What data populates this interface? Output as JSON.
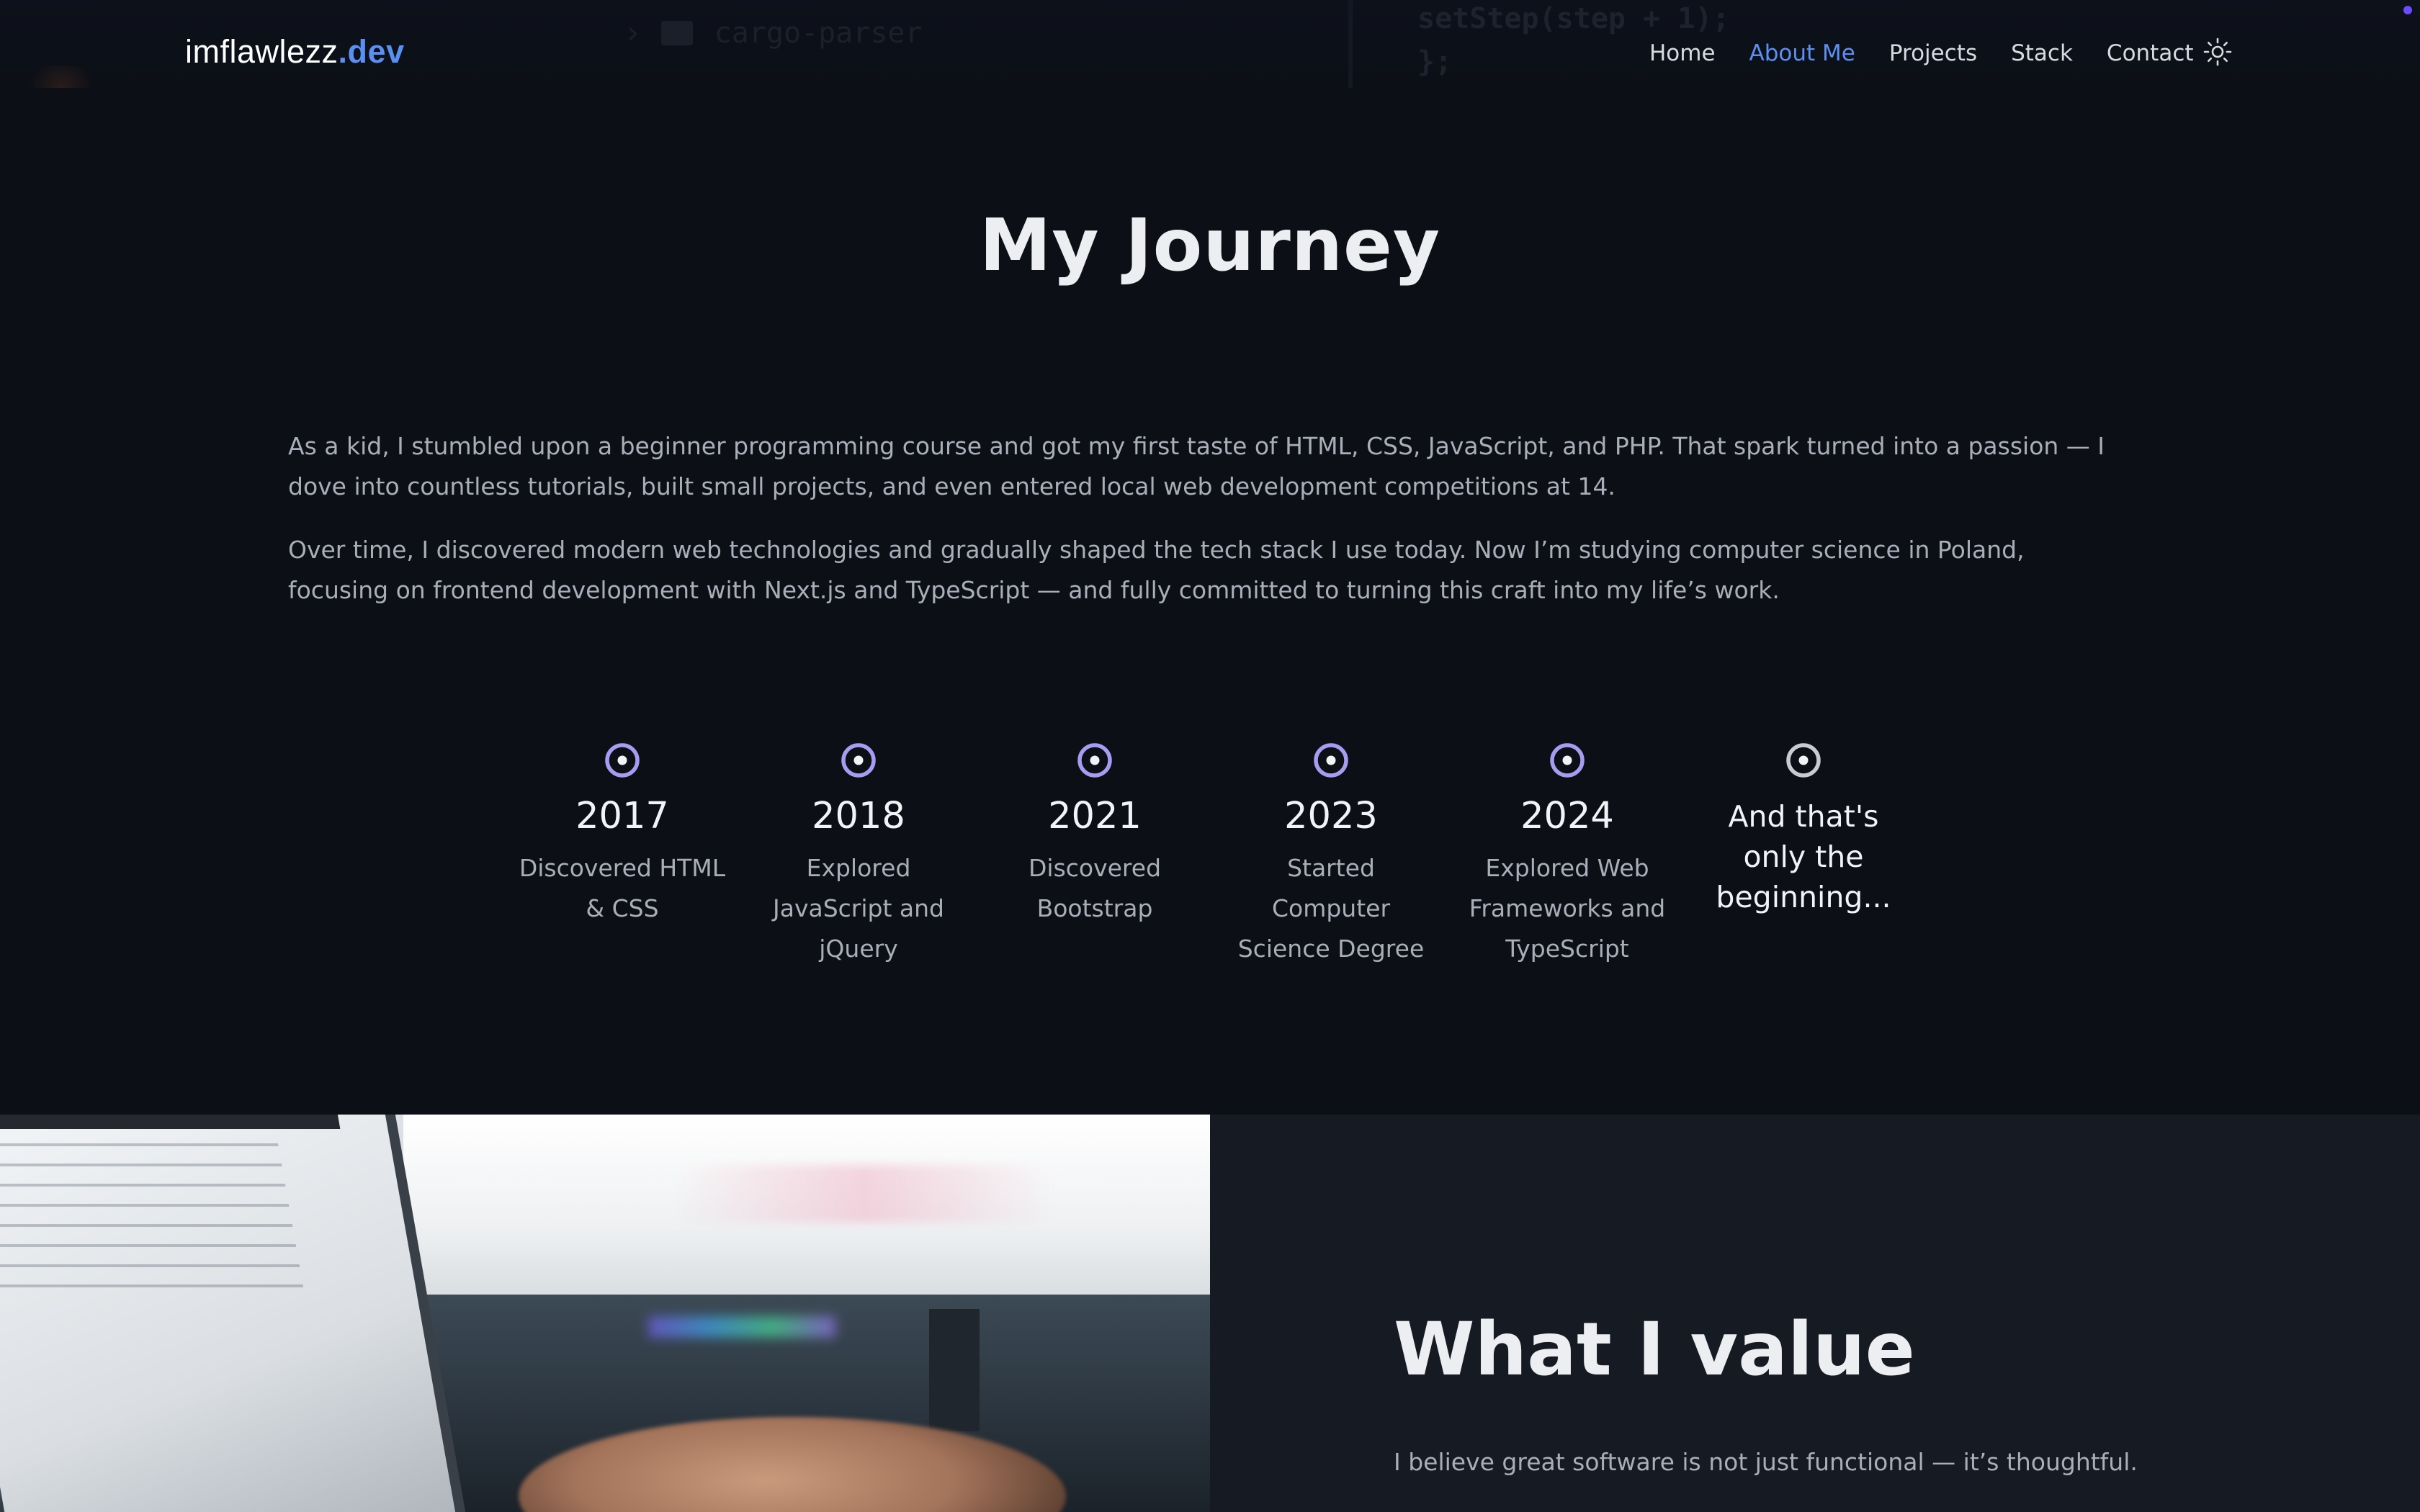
{
  "nav": {
    "logo_main": "imflawlezz",
    "logo_accent": ".dev",
    "links": [
      {
        "label": "Home",
        "active": false
      },
      {
        "label": "About Me",
        "active": true
      },
      {
        "label": "Projects",
        "active": false
      },
      {
        "label": "Stack",
        "active": false
      },
      {
        "label": "Contact",
        "active": false
      }
    ],
    "theme_icon": "sun-icon",
    "background_code_line1": "setStep(step + 1);",
    "background_code_line2": "};",
    "background_folder": "cargo-parser"
  },
  "journey": {
    "title": "My Journey",
    "paragraphs": [
      "As a kid, I stumbled upon a beginner programming course and got my first taste of HTML, CSS, JavaScript, and PHP. That spark turned into a passion — I dove into countless tutorials, built small projects, and even entered local web development competitions at 14.",
      "Over time, I discovered modern web technologies and gradually shaped the tech stack I use today. Now I’m studying computer science in Poland, focusing on frontend development with Next.js and TypeScript — and fully committed to turning this craft into my life’s work."
    ],
    "timeline": [
      {
        "year": "2017",
        "desc": "Discovered HTML & CSS"
      },
      {
        "year": "2018",
        "desc": "Explored JavaScript and jQuery"
      },
      {
        "year": "2021",
        "desc": "Discovered Bootstrap"
      },
      {
        "year": "2023",
        "desc": "Started Computer Science Degree"
      },
      {
        "year": "2024",
        "desc": "Explored Web Frameworks and TypeScript"
      }
    ],
    "timeline_final": "And that's only the beginning...",
    "accent_color": "#a89cf0",
    "final_icon_color": "#c8cbd2"
  },
  "values": {
    "title": "What I value",
    "text": "I believe great software is not just functional — it’s thoughtful."
  }
}
